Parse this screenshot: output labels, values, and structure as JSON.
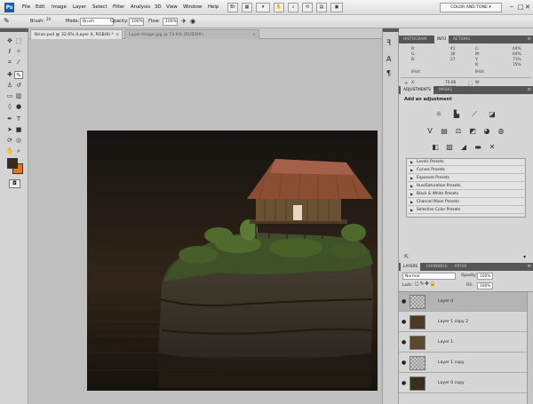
{
  "menubar": {
    "logo": "Ps",
    "items": [
      "File",
      "Edit",
      "Image",
      "Layer",
      "Select",
      "Filter",
      "Analysis",
      "3D",
      "View",
      "Window",
      "Help"
    ],
    "workspace": "COLOR AND TONE"
  },
  "options": {
    "brush_label": "Brush:",
    "brush_size": "20",
    "mode_label": "Mode:",
    "mode_value": "Brush",
    "opacity_label": "Opacity:",
    "opacity_value": "100%",
    "flow_label": "Flow:",
    "flow_value": "100%"
  },
  "doc_tabs": [
    {
      "label": "Brian.psd @ 32.6% (Layer 4, RGB/8) *",
      "active": true
    },
    {
      "label": "Layer.image.jpg @ 73.6% (RGB/8#)",
      "active": false
    }
  ],
  "info_panel": {
    "tabs": [
      "HISTOGRAM",
      "INFO",
      "ACTIONS"
    ],
    "active_tab": "INFO",
    "rgb_labels": [
      "R:",
      "G:",
      "B:"
    ],
    "rgb_values": [
      "41",
      "36",
      "27"
    ],
    "cmyk_labels": [
      "C:",
      "M:",
      "Y:",
      "K:"
    ],
    "cmyk_values": [
      "64%",
      "64%",
      "71%",
      "75%"
    ],
    "bit_left": "8-bit",
    "bit_right": "8-bit",
    "xy_labels": [
      "X:",
      "Y:"
    ],
    "xy_values": [
      "70.66",
      "55.38"
    ],
    "wh_labels": [
      "W:",
      "H:"
    ]
  },
  "adjustments": {
    "tabs": [
      "ADJUSTMENTS",
      "MASKS"
    ],
    "active_tab": "ADJUSTMENTS",
    "title": "Add an adjustment",
    "presets": [
      "Levels Presets",
      "Curves Presets",
      "Exposure Presets",
      "Hue/Saturation Presets",
      "Black & White Presets",
      "Channel Mixer Presets",
      "Selective Color Presets"
    ]
  },
  "layers": {
    "tabs": [
      "LAYERS",
      "CHANNELS",
      "PATHS"
    ],
    "active_tab": "LAYERS",
    "blend_mode": "Normal",
    "opacity_label": "Opacity:",
    "opacity_value": "100%",
    "lock_label": "Lock:",
    "fill_label": "Fill:",
    "fill_value": "100%",
    "items": [
      {
        "name": "Layer 4",
        "selected": true
      },
      {
        "name": "Layer 1 copy 2",
        "selected": false
      },
      {
        "name": "Layer 1",
        "selected": false
      },
      {
        "name": "Layer 1 copy",
        "selected": false
      },
      {
        "name": "Layer 0 copy",
        "selected": false
      }
    ]
  },
  "colors": {
    "foreground": "#3a2818",
    "background": "#e07a10",
    "accent": "#1b5aa6"
  }
}
